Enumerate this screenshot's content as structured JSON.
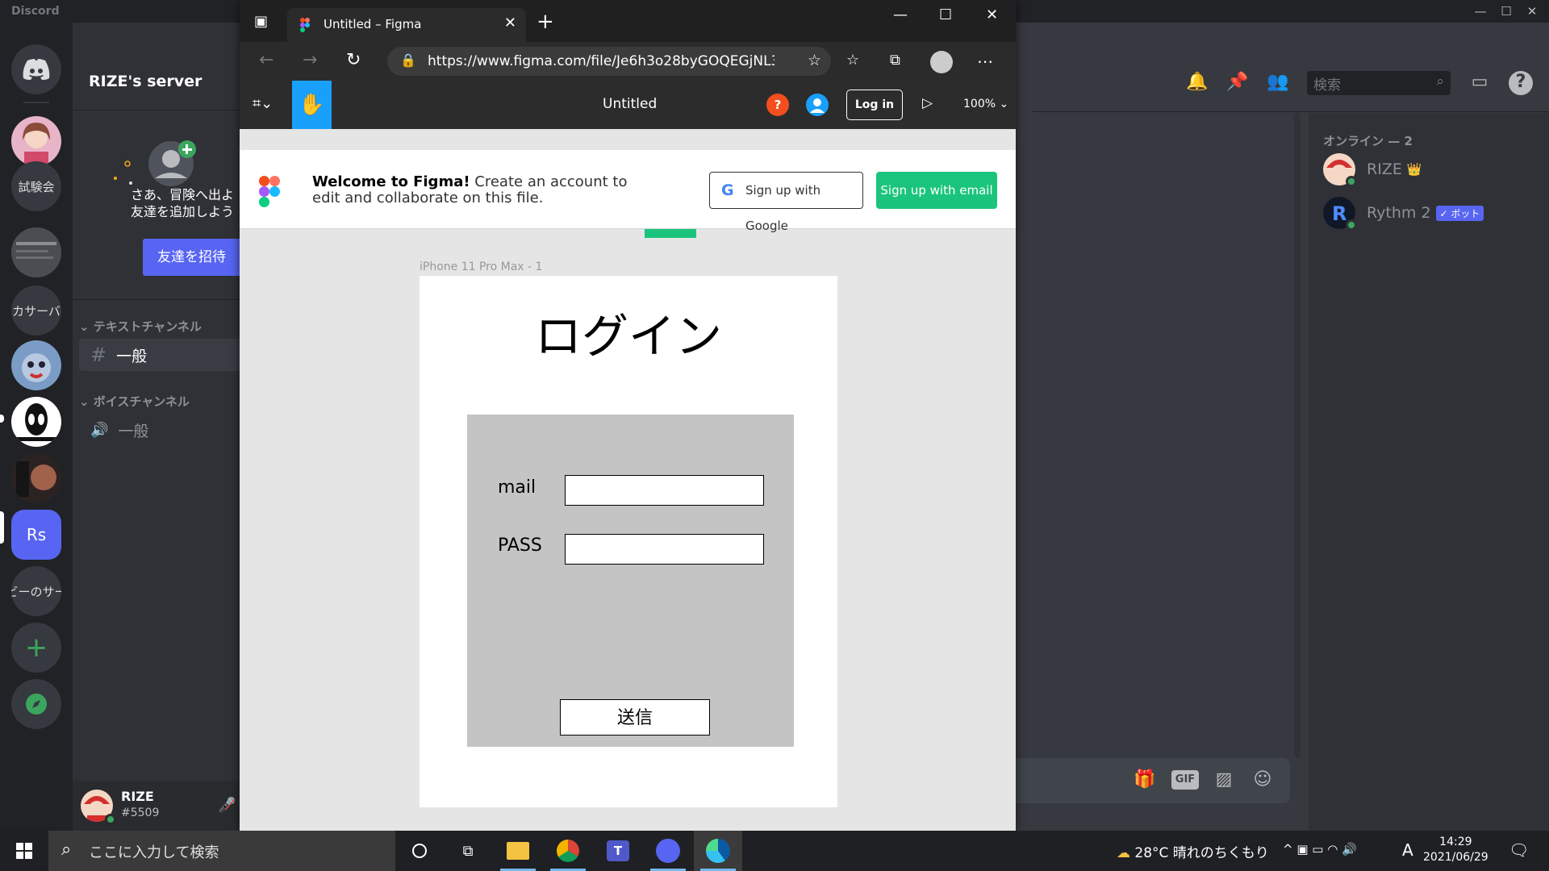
{
  "discord": {
    "app_title": "Discord",
    "server_name": "RIZE's server",
    "invite_text_line1": "さあ、冒険へ出よ",
    "invite_text_line2": "友達を追加しよう",
    "invite_button": "友達を招待",
    "guilds": [
      {
        "label": "試験会"
      },
      {
        "label": "カサーバ"
      },
      {
        "label": "Rs"
      },
      {
        "label": "ビーのサー"
      }
    ],
    "categories": [
      {
        "name": "テキストチャンネル",
        "channel": "一般",
        "symbol": "#"
      },
      {
        "name": "ボイスチャンネル",
        "channel": "一般",
        "symbol": "🔊"
      }
    ],
    "user": {
      "name": "RIZE",
      "tag": "#5509"
    },
    "search_placeholder": "検索",
    "online_header": "オンライン — 2",
    "members": [
      {
        "name": "RIZE",
        "badge": "👑"
      },
      {
        "name": "Rythm 2",
        "badge": "✓ ボット"
      }
    ],
    "composer": {
      "gif": "GIF"
    }
  },
  "browser": {
    "tab_title": "Untitled – Figma",
    "url": "https://www.figma.com/file/Je6h3o28byGOQEGjNL3G..."
  },
  "figma": {
    "file_title": "Untitled",
    "help": "?",
    "login_button": "Log in",
    "zoom": "100%",
    "banner": {
      "bold": "Welcome to Figma!",
      "rest": " Create an account to edit and collaborate on this file.",
      "google_button": "Sign up with Google",
      "email_button": "Sign up with email"
    },
    "frame_label": "iPhone 11 Pro Max - 1",
    "frame_title": "ログイン",
    "mail_label": "mail",
    "pass_label": "PASS",
    "submit_label": "送信"
  },
  "taskbar": {
    "search_placeholder": "ここに入力して検索",
    "weather": "28°C  晴れのちくもり",
    "time": "14:29",
    "date": "2021/06/29",
    "ime": "A"
  },
  "colors": {
    "discord_blurple": "#5865f2",
    "figma_blue": "#18a0fb",
    "figma_green": "#1bc47d",
    "figma_help": "#f24e1e"
  }
}
